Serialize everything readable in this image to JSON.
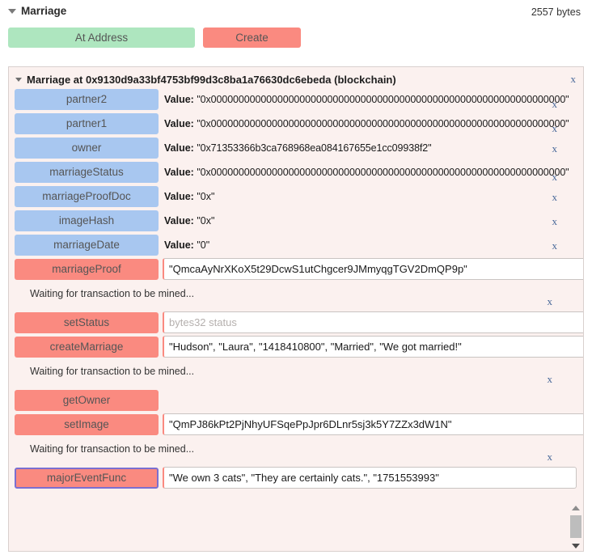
{
  "header": {
    "title": "Marriage",
    "bytes": "2557 bytes",
    "collapse_icon": "caret-down-icon"
  },
  "top_actions": {
    "at_address_label": "At Address",
    "create_label": "Create"
  },
  "contract_panel": {
    "title": "Marriage at 0x9130d9a33bf4753bf99d3c8ba1a76630dc6ebeda (blockchain)",
    "close_label": "x",
    "collapse_icon": "caret-down-icon",
    "getter_rows": [
      {
        "name": "partner2",
        "value_prefix": "Value:",
        "value": "\"0x0000000000000000000000000000000000000000000000000000000000000000\"",
        "close_label": "x"
      },
      {
        "name": "partner1",
        "value_prefix": "Value:",
        "value": "\"0x0000000000000000000000000000000000000000000000000000000000000000\"",
        "close_label": "x"
      },
      {
        "name": "owner",
        "value_prefix": "Value:",
        "value": "\"0x71353366b3ca768968ea084167655e1cc09938f2\"",
        "close_label": "x"
      },
      {
        "name": "marriageStatus",
        "value_prefix": "Value:",
        "value": "\"0x0000000000000000000000000000000000000000000000000000000000000000\"",
        "close_label": "x"
      },
      {
        "name": "marriageProofDoc",
        "value_prefix": "Value:",
        "value": "\"0x\"",
        "close_label": "x"
      },
      {
        "name": "imageHash",
        "value_prefix": "Value:",
        "value": "\"0x\"",
        "close_label": "x"
      },
      {
        "name": "marriageDate",
        "value_prefix": "Value:",
        "value": "\"0\"",
        "close_label": "x"
      }
    ],
    "function_rows": [
      {
        "name": "marriageProof",
        "input_value": "\"QmcaAyNrXKoX5t29DcwS1utChgcer9JMmyqgTGV2DmQP9p\"",
        "input_placeholder": ""
      },
      {
        "name": "setStatus",
        "input_value": "",
        "input_placeholder": "bytes32 status"
      },
      {
        "name": "createMarriage",
        "input_value": "\"Hudson\", \"Laura\", \"1418410800\", \"Married\", \"We got married!\"",
        "input_placeholder": ""
      },
      {
        "name": "getOwner",
        "input_value": null,
        "input_placeholder": ""
      },
      {
        "name": "setImage",
        "input_value": "\"QmPJ86kPt2PjNhyUFSqePpJpr6DLnr5sj3k5Y7ZZx3dW1N\"",
        "input_placeholder": ""
      },
      {
        "name": "majorEventFunc",
        "input_value": "\"We own 3 cats\", \"They are certainly cats.\", \"1751553993\"",
        "input_placeholder": ""
      }
    ],
    "status_messages": [
      {
        "text": "Waiting for transaction to be mined...",
        "close_label": "x"
      },
      {
        "text": "Waiting for transaction to be mined...",
        "close_label": "x"
      },
      {
        "text": "Waiting for transaction to be mined...",
        "close_label": "x"
      }
    ],
    "scrollbar": {
      "up_icon": "triangle-up-icon",
      "down_icon": "triangle-down-icon",
      "thumb": "scrollbar-thumb"
    }
  },
  "colors": {
    "getter_button": "#a8c7f0",
    "function_button": "#fa8a80",
    "at_address_button": "#aee6bf",
    "panel_background": "#fbf1ef",
    "focus_outline": "#7b6fd0"
  }
}
